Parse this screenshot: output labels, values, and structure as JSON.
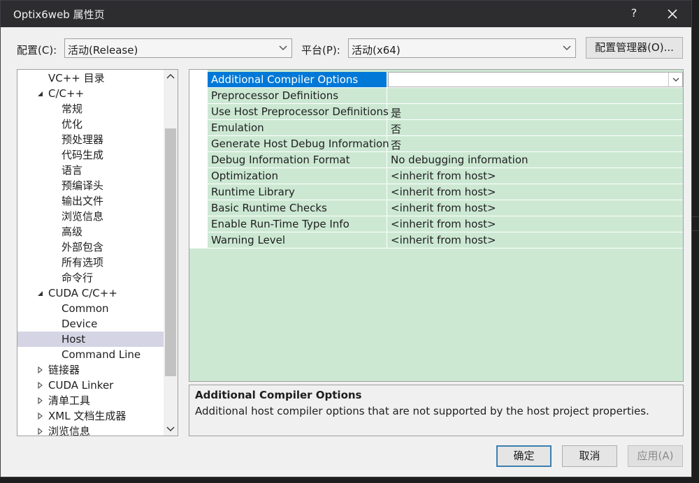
{
  "window": {
    "title": "Optix6web 属性页",
    "help_label": "?"
  },
  "config": {
    "label": "配置(C):",
    "value": "活动(Release)"
  },
  "platform": {
    "label": "平台(P):",
    "value": "活动(x64)"
  },
  "config_manager_label": "配置管理器(O)...",
  "tree": {
    "items": [
      {
        "label": "VC++ 目录",
        "level": 1,
        "expander": ""
      },
      {
        "label": "C/C++",
        "level": 1,
        "expander": "expanded"
      },
      {
        "label": "常规",
        "level": 2,
        "expander": ""
      },
      {
        "label": "优化",
        "level": 2,
        "expander": ""
      },
      {
        "label": "预处理器",
        "level": 2,
        "expander": ""
      },
      {
        "label": "代码生成",
        "level": 2,
        "expander": ""
      },
      {
        "label": "语言",
        "level": 2,
        "expander": ""
      },
      {
        "label": "预编译头",
        "level": 2,
        "expander": ""
      },
      {
        "label": "输出文件",
        "level": 2,
        "expander": ""
      },
      {
        "label": "浏览信息",
        "level": 2,
        "expander": ""
      },
      {
        "label": "高级",
        "level": 2,
        "expander": ""
      },
      {
        "label": "外部包含",
        "level": 2,
        "expander": ""
      },
      {
        "label": "所有选项",
        "level": 2,
        "expander": ""
      },
      {
        "label": "命令行",
        "level": 2,
        "expander": ""
      },
      {
        "label": "CUDA C/C++",
        "level": 1,
        "expander": "expanded"
      },
      {
        "label": "Common",
        "level": 2,
        "expander": ""
      },
      {
        "label": "Device",
        "level": 2,
        "expander": ""
      },
      {
        "label": "Host",
        "level": 2,
        "expander": "",
        "selected": true
      },
      {
        "label": "Command Line",
        "level": 2,
        "expander": ""
      },
      {
        "label": "链接器",
        "level": 1,
        "expander": "collapsed"
      },
      {
        "label": "CUDA Linker",
        "level": 1,
        "expander": "collapsed"
      },
      {
        "label": "清单工具",
        "level": 1,
        "expander": "collapsed"
      },
      {
        "label": "XML 文档生成器",
        "level": 1,
        "expander": "collapsed"
      },
      {
        "label": "浏览信息",
        "level": 1,
        "expander": "collapsed"
      }
    ]
  },
  "properties": [
    {
      "name": "Additional Compiler Options",
      "value": "",
      "selected": true
    },
    {
      "name": "Preprocessor Definitions",
      "value": ""
    },
    {
      "name": "Use Host Preprocessor Definitions",
      "value": "是"
    },
    {
      "name": "Emulation",
      "value": "否"
    },
    {
      "name": "Generate Host Debug Information",
      "value": "否"
    },
    {
      "name": "Debug Information Format",
      "value": "No debugging information"
    },
    {
      "name": "Optimization",
      "value": "<inherit from host>"
    },
    {
      "name": "Runtime Library",
      "value": "<inherit from host>"
    },
    {
      "name": "Basic Runtime Checks",
      "value": "<inherit from host>"
    },
    {
      "name": "Enable Run-Time Type Info",
      "value": "<inherit from host>"
    },
    {
      "name": "Warning Level",
      "value": "<inherit from host>"
    }
  ],
  "description": {
    "title": "Additional Compiler Options",
    "text": "Additional host compiler options that are not supported by the host project properties."
  },
  "buttons": {
    "ok": "确定",
    "cancel": "取消",
    "apply": "应用(A)"
  },
  "colors": {
    "titlebar": "#2d2d30",
    "grid_background": "#cce8d3",
    "selection_blue": "#0078d7",
    "tree_selection": "#d4d4e4"
  }
}
